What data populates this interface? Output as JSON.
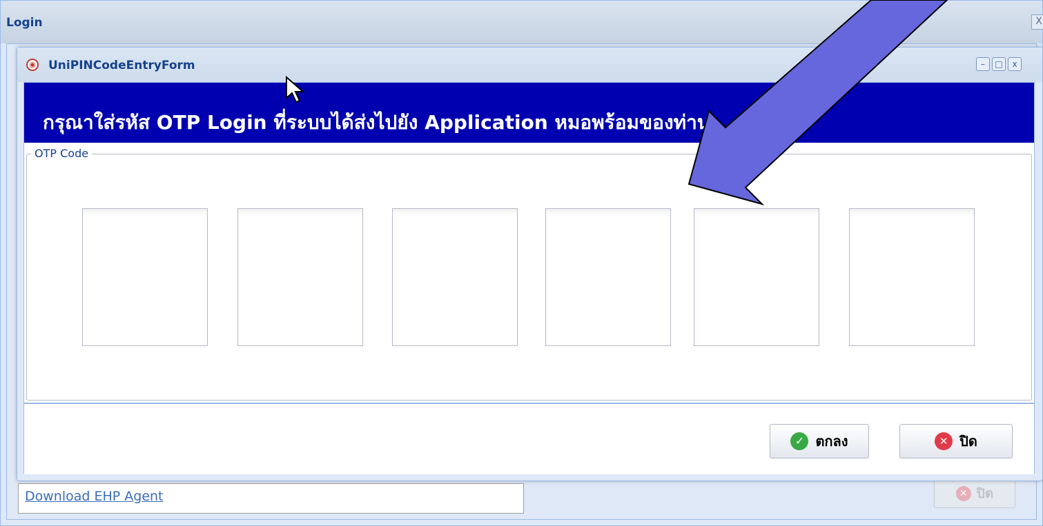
{
  "login_window": {
    "title": "Login",
    "close_glyph": "X",
    "download_link": "Download EHP Agent",
    "bg_close_label": "ปิด"
  },
  "modal": {
    "title": "UniPINCodeEntryForm",
    "banner": "กรุณาใส่รหัส OTP Login ที่ระบบได้ส่งไปยัง Application หมอพร้อมของท่าน",
    "fieldset_legend": "OTP Code",
    "otp_values": [
      "",
      "",
      "",
      "",
      "",
      ""
    ],
    "ok_label": "ตกลง",
    "close_label": "ปิด",
    "window_buttons": {
      "minimize": "–",
      "maximize": "□",
      "close": "x"
    }
  },
  "colors": {
    "banner_bg": "#0000b0",
    "arrow_fill": "#6666dd",
    "ok_icon": "#3aa845",
    "close_icon": "#df3b4b"
  },
  "icons": [
    "app-icon",
    "minimize-icon",
    "maximize-icon",
    "close-icon",
    "check-icon",
    "x-icon",
    "mouse-cursor-icon",
    "annotation-arrow"
  ]
}
